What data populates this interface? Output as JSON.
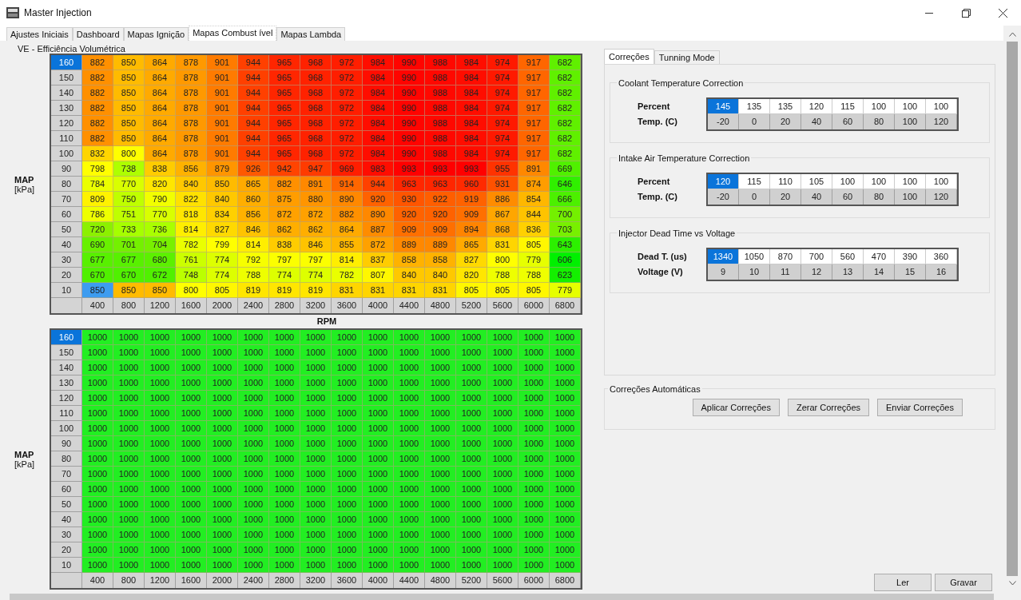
{
  "window": {
    "title": "Master Injection"
  },
  "tabs": [
    {
      "label": "Ajustes Iniciais",
      "selected": false
    },
    {
      "label": "Dashboard",
      "selected": false
    },
    {
      "label": "Mapas Ignição",
      "selected": false
    },
    {
      "label": "Mapas Combust ível",
      "selected": true
    },
    {
      "label": "Mapas Lambda",
      "selected": false
    }
  ],
  "ve_table": {
    "title": "VE - Efficiência Volumétrica",
    "y_label": "MAP",
    "y_unit": "[kPa]",
    "rows": [
      {
        "label": "160",
        "selected": true,
        "cells": [
          {
            "value": "882",
            "selected": false
          },
          {
            "value": "850",
            "selected": false
          },
          {
            "value": "864",
            "selected": false
          },
          {
            "value": "878",
            "selected": false
          },
          {
            "value": "901",
            "selected": false
          },
          {
            "value": "944",
            "selected": false
          },
          {
            "value": "965",
            "selected": false
          },
          {
            "value": "968",
            "selected": false
          },
          {
            "value": "972",
            "selected": false
          },
          {
            "value": "984",
            "selected": false
          },
          {
            "value": "990",
            "selected": false
          },
          {
            "value": "988",
            "selected": false
          },
          {
            "value": "984",
            "selected": false
          },
          {
            "value": "974",
            "selected": false
          },
          {
            "value": "917",
            "selected": false
          },
          {
            "value": "682",
            "selected": false
          }
        ]
      },
      {
        "label": "150",
        "selected": false,
        "cells": [
          {
            "value": "882",
            "selected": false
          },
          {
            "value": "850",
            "selected": false
          },
          {
            "value": "864",
            "selected": false
          },
          {
            "value": "878",
            "selected": false
          },
          {
            "value": "901",
            "selected": false
          },
          {
            "value": "944",
            "selected": false
          },
          {
            "value": "965",
            "selected": false
          },
          {
            "value": "968",
            "selected": false
          },
          {
            "value": "972",
            "selected": false
          },
          {
            "value": "984",
            "selected": false
          },
          {
            "value": "990",
            "selected": false
          },
          {
            "value": "988",
            "selected": false
          },
          {
            "value": "984",
            "selected": false
          },
          {
            "value": "974",
            "selected": false
          },
          {
            "value": "917",
            "selected": false
          },
          {
            "value": "682",
            "selected": false
          }
        ]
      },
      {
        "label": "140",
        "selected": false,
        "cells": [
          {
            "value": "882",
            "selected": false
          },
          {
            "value": "850",
            "selected": false
          },
          {
            "value": "864",
            "selected": false
          },
          {
            "value": "878",
            "selected": false
          },
          {
            "value": "901",
            "selected": false
          },
          {
            "value": "944",
            "selected": false
          },
          {
            "value": "965",
            "selected": false
          },
          {
            "value": "968",
            "selected": false
          },
          {
            "value": "972",
            "selected": false
          },
          {
            "value": "984",
            "selected": false
          },
          {
            "value": "990",
            "selected": false
          },
          {
            "value": "988",
            "selected": false
          },
          {
            "value": "984",
            "selected": false
          },
          {
            "value": "974",
            "selected": false
          },
          {
            "value": "917",
            "selected": false
          },
          {
            "value": "682",
            "selected": false
          }
        ]
      },
      {
        "label": "130",
        "selected": false,
        "cells": [
          {
            "value": "882",
            "selected": false
          },
          {
            "value": "850",
            "selected": false
          },
          {
            "value": "864",
            "selected": false
          },
          {
            "value": "878",
            "selected": false
          },
          {
            "value": "901",
            "selected": false
          },
          {
            "value": "944",
            "selected": false
          },
          {
            "value": "965",
            "selected": false
          },
          {
            "value": "968",
            "selected": false
          },
          {
            "value": "972",
            "selected": false
          },
          {
            "value": "984",
            "selected": false
          },
          {
            "value": "990",
            "selected": false
          },
          {
            "value": "988",
            "selected": false
          },
          {
            "value": "984",
            "selected": false
          },
          {
            "value": "974",
            "selected": false
          },
          {
            "value": "917",
            "selected": false
          },
          {
            "value": "682",
            "selected": false
          }
        ]
      },
      {
        "label": "120",
        "selected": false,
        "cells": [
          {
            "value": "882",
            "selected": false
          },
          {
            "value": "850",
            "selected": false
          },
          {
            "value": "864",
            "selected": false
          },
          {
            "value": "878",
            "selected": false
          },
          {
            "value": "901",
            "selected": false
          },
          {
            "value": "944",
            "selected": false
          },
          {
            "value": "965",
            "selected": false
          },
          {
            "value": "968",
            "selected": false
          },
          {
            "value": "972",
            "selected": false
          },
          {
            "value": "984",
            "selected": false
          },
          {
            "value": "990",
            "selected": false
          },
          {
            "value": "988",
            "selected": false
          },
          {
            "value": "984",
            "selected": false
          },
          {
            "value": "974",
            "selected": false
          },
          {
            "value": "917",
            "selected": false
          },
          {
            "value": "682",
            "selected": false
          }
        ]
      },
      {
        "label": "110",
        "selected": false,
        "cells": [
          {
            "value": "882",
            "selected": false
          },
          {
            "value": "850",
            "selected": false
          },
          {
            "value": "864",
            "selected": false
          },
          {
            "value": "878",
            "selected": false
          },
          {
            "value": "901",
            "selected": false
          },
          {
            "value": "944",
            "selected": false
          },
          {
            "value": "965",
            "selected": false
          },
          {
            "value": "968",
            "selected": false
          },
          {
            "value": "972",
            "selected": false
          },
          {
            "value": "984",
            "selected": false
          },
          {
            "value": "990",
            "selected": false
          },
          {
            "value": "988",
            "selected": false
          },
          {
            "value": "984",
            "selected": false
          },
          {
            "value": "974",
            "selected": false
          },
          {
            "value": "917",
            "selected": false
          },
          {
            "value": "682",
            "selected": false
          }
        ]
      },
      {
        "label": "100",
        "selected": false,
        "cells": [
          {
            "value": "832",
            "selected": false
          },
          {
            "value": "800",
            "selected": false
          },
          {
            "value": "864",
            "selected": false
          },
          {
            "value": "878",
            "selected": false
          },
          {
            "value": "901",
            "selected": false
          },
          {
            "value": "944",
            "selected": false
          },
          {
            "value": "965",
            "selected": false
          },
          {
            "value": "968",
            "selected": false
          },
          {
            "value": "972",
            "selected": false
          },
          {
            "value": "984",
            "selected": false
          },
          {
            "value": "990",
            "selected": false
          },
          {
            "value": "988",
            "selected": false
          },
          {
            "value": "984",
            "selected": false
          },
          {
            "value": "974",
            "selected": false
          },
          {
            "value": "917",
            "selected": false
          },
          {
            "value": "682",
            "selected": false
          }
        ]
      },
      {
        "label": "90",
        "selected": false,
        "cells": [
          {
            "value": "798",
            "selected": false
          },
          {
            "value": "738",
            "selected": false
          },
          {
            "value": "838",
            "selected": false
          },
          {
            "value": "856",
            "selected": false
          },
          {
            "value": "879",
            "selected": false
          },
          {
            "value": "926",
            "selected": false
          },
          {
            "value": "942",
            "selected": false
          },
          {
            "value": "947",
            "selected": false
          },
          {
            "value": "969",
            "selected": false
          },
          {
            "value": "983",
            "selected": false
          },
          {
            "value": "993",
            "selected": false
          },
          {
            "value": "993",
            "selected": false
          },
          {
            "value": "993",
            "selected": false
          },
          {
            "value": "955",
            "selected": false
          },
          {
            "value": "891",
            "selected": false
          },
          {
            "value": "669",
            "selected": false
          }
        ]
      },
      {
        "label": "80",
        "selected": false,
        "cells": [
          {
            "value": "784",
            "selected": false
          },
          {
            "value": "770",
            "selected": false
          },
          {
            "value": "820",
            "selected": false
          },
          {
            "value": "840",
            "selected": false
          },
          {
            "value": "850",
            "selected": false
          },
          {
            "value": "865",
            "selected": false
          },
          {
            "value": "882",
            "selected": false
          },
          {
            "value": "891",
            "selected": false
          },
          {
            "value": "914",
            "selected": false
          },
          {
            "value": "944",
            "selected": false
          },
          {
            "value": "963",
            "selected": false
          },
          {
            "value": "963",
            "selected": false
          },
          {
            "value": "960",
            "selected": false
          },
          {
            "value": "931",
            "selected": false
          },
          {
            "value": "874",
            "selected": false
          },
          {
            "value": "646",
            "selected": false
          }
        ]
      },
      {
        "label": "70",
        "selected": false,
        "cells": [
          {
            "value": "809",
            "selected": false
          },
          {
            "value": "750",
            "selected": false
          },
          {
            "value": "790",
            "selected": false
          },
          {
            "value": "822",
            "selected": false
          },
          {
            "value": "840",
            "selected": false
          },
          {
            "value": "860",
            "selected": false
          },
          {
            "value": "875",
            "selected": false
          },
          {
            "value": "880",
            "selected": false
          },
          {
            "value": "890",
            "selected": false
          },
          {
            "value": "920",
            "selected": false
          },
          {
            "value": "930",
            "selected": false
          },
          {
            "value": "922",
            "selected": false
          },
          {
            "value": "919",
            "selected": false
          },
          {
            "value": "886",
            "selected": false
          },
          {
            "value": "854",
            "selected": false
          },
          {
            "value": "666",
            "selected": false
          }
        ]
      },
      {
        "label": "60",
        "selected": false,
        "cells": [
          {
            "value": "786",
            "selected": false
          },
          {
            "value": "751",
            "selected": false
          },
          {
            "value": "770",
            "selected": false
          },
          {
            "value": "818",
            "selected": false
          },
          {
            "value": "834",
            "selected": false
          },
          {
            "value": "856",
            "selected": false
          },
          {
            "value": "872",
            "selected": false
          },
          {
            "value": "872",
            "selected": false
          },
          {
            "value": "882",
            "selected": false
          },
          {
            "value": "890",
            "selected": false
          },
          {
            "value": "920",
            "selected": false
          },
          {
            "value": "920",
            "selected": false
          },
          {
            "value": "909",
            "selected": false
          },
          {
            "value": "867",
            "selected": false
          },
          {
            "value": "844",
            "selected": false
          },
          {
            "value": "700",
            "selected": false
          }
        ]
      },
      {
        "label": "50",
        "selected": false,
        "cells": [
          {
            "value": "720",
            "selected": false
          },
          {
            "value": "733",
            "selected": false
          },
          {
            "value": "736",
            "selected": false
          },
          {
            "value": "814",
            "selected": false
          },
          {
            "value": "827",
            "selected": false
          },
          {
            "value": "846",
            "selected": false
          },
          {
            "value": "862",
            "selected": false
          },
          {
            "value": "862",
            "selected": false
          },
          {
            "value": "864",
            "selected": false
          },
          {
            "value": "887",
            "selected": false
          },
          {
            "value": "909",
            "selected": false
          },
          {
            "value": "909",
            "selected": false
          },
          {
            "value": "894",
            "selected": false
          },
          {
            "value": "868",
            "selected": false
          },
          {
            "value": "836",
            "selected": false
          },
          {
            "value": "703",
            "selected": false
          }
        ]
      },
      {
        "label": "40",
        "selected": false,
        "cells": [
          {
            "value": "690",
            "selected": false
          },
          {
            "value": "701",
            "selected": false
          },
          {
            "value": "704",
            "selected": false
          },
          {
            "value": "782",
            "selected": false
          },
          {
            "value": "799",
            "selected": false
          },
          {
            "value": "814",
            "selected": false
          },
          {
            "value": "838",
            "selected": false
          },
          {
            "value": "846",
            "selected": false
          },
          {
            "value": "855",
            "selected": false
          },
          {
            "value": "872",
            "selected": false
          },
          {
            "value": "889",
            "selected": false
          },
          {
            "value": "889",
            "selected": false
          },
          {
            "value": "865",
            "selected": false
          },
          {
            "value": "831",
            "selected": false
          },
          {
            "value": "805",
            "selected": false
          },
          {
            "value": "643",
            "selected": false
          }
        ]
      },
      {
        "label": "30",
        "selected": false,
        "cells": [
          {
            "value": "677",
            "selected": false
          },
          {
            "value": "677",
            "selected": false
          },
          {
            "value": "680",
            "selected": false
          },
          {
            "value": "761",
            "selected": false
          },
          {
            "value": "774",
            "selected": false
          },
          {
            "value": "792",
            "selected": false
          },
          {
            "value": "797",
            "selected": false
          },
          {
            "value": "797",
            "selected": false
          },
          {
            "value": "814",
            "selected": false
          },
          {
            "value": "837",
            "selected": false
          },
          {
            "value": "858",
            "selected": false
          },
          {
            "value": "858",
            "selected": false
          },
          {
            "value": "827",
            "selected": false
          },
          {
            "value": "800",
            "selected": false
          },
          {
            "value": "779",
            "selected": false
          },
          {
            "value": "606",
            "selected": false
          }
        ]
      },
      {
        "label": "20",
        "selected": false,
        "cells": [
          {
            "value": "670",
            "selected": false
          },
          {
            "value": "670",
            "selected": false
          },
          {
            "value": "672",
            "selected": false
          },
          {
            "value": "748",
            "selected": false
          },
          {
            "value": "774",
            "selected": false
          },
          {
            "value": "788",
            "selected": false
          },
          {
            "value": "774",
            "selected": false
          },
          {
            "value": "774",
            "selected": false
          },
          {
            "value": "782",
            "selected": false
          },
          {
            "value": "807",
            "selected": false
          },
          {
            "value": "840",
            "selected": false
          },
          {
            "value": "840",
            "selected": false
          },
          {
            "value": "820",
            "selected": false
          },
          {
            "value": "788",
            "selected": false
          },
          {
            "value": "788",
            "selected": false
          },
          {
            "value": "623",
            "selected": false
          }
        ]
      },
      {
        "label": "10",
        "selected": false,
        "cells": [
          {
            "value": "850",
            "selected": true
          },
          {
            "value": "850",
            "selected": false
          },
          {
            "value": "850",
            "selected": false
          },
          {
            "value": "800",
            "selected": false
          },
          {
            "value": "805",
            "selected": false
          },
          {
            "value": "819",
            "selected": false
          },
          {
            "value": "819",
            "selected": false
          },
          {
            "value": "819",
            "selected": false
          },
          {
            "value": "831",
            "selected": false
          },
          {
            "value": "831",
            "selected": false
          },
          {
            "value": "831",
            "selected": false
          },
          {
            "value": "831",
            "selected": false
          },
          {
            "value": "805",
            "selected": false
          },
          {
            "value": "805",
            "selected": false
          },
          {
            "value": "805",
            "selected": false
          },
          {
            "value": "779",
            "selected": false
          }
        ]
      }
    ],
    "x_axis": [
      "400",
      "800",
      "1200",
      "1600",
      "2000",
      "2400",
      "2800",
      "3200",
      "3600",
      "4000",
      "4400",
      "4800",
      "5200",
      "5600",
      "6000",
      "6800"
    ],
    "x_label": "RPM"
  },
  "second_table": {
    "y_label": "MAP",
    "y_unit": "[kPa]",
    "rows": [
      {
        "label": "160",
        "selected": true,
        "cells": [
          "1000",
          "1000",
          "1000",
          "1000",
          "1000",
          "1000",
          "1000",
          "1000",
          "1000",
          "1000",
          "1000",
          "1000",
          "1000",
          "1000",
          "1000",
          "1000"
        ]
      },
      {
        "label": "150",
        "selected": false,
        "cells": [
          "1000",
          "1000",
          "1000",
          "1000",
          "1000",
          "1000",
          "1000",
          "1000",
          "1000",
          "1000",
          "1000",
          "1000",
          "1000",
          "1000",
          "1000",
          "1000"
        ]
      },
      {
        "label": "140",
        "selected": false,
        "cells": [
          "1000",
          "1000",
          "1000",
          "1000",
          "1000",
          "1000",
          "1000",
          "1000",
          "1000",
          "1000",
          "1000",
          "1000",
          "1000",
          "1000",
          "1000",
          "1000"
        ]
      },
      {
        "label": "130",
        "selected": false,
        "cells": [
          "1000",
          "1000",
          "1000",
          "1000",
          "1000",
          "1000",
          "1000",
          "1000",
          "1000",
          "1000",
          "1000",
          "1000",
          "1000",
          "1000",
          "1000",
          "1000"
        ]
      },
      {
        "label": "120",
        "selected": false,
        "cells": [
          "1000",
          "1000",
          "1000",
          "1000",
          "1000",
          "1000",
          "1000",
          "1000",
          "1000",
          "1000",
          "1000",
          "1000",
          "1000",
          "1000",
          "1000",
          "1000"
        ]
      },
      {
        "label": "110",
        "selected": false,
        "cells": [
          "1000",
          "1000",
          "1000",
          "1000",
          "1000",
          "1000",
          "1000",
          "1000",
          "1000",
          "1000",
          "1000",
          "1000",
          "1000",
          "1000",
          "1000",
          "1000"
        ]
      },
      {
        "label": "100",
        "selected": false,
        "cells": [
          "1000",
          "1000",
          "1000",
          "1000",
          "1000",
          "1000",
          "1000",
          "1000",
          "1000",
          "1000",
          "1000",
          "1000",
          "1000",
          "1000",
          "1000",
          "1000"
        ]
      },
      {
        "label": "90",
        "selected": false,
        "cells": [
          "1000",
          "1000",
          "1000",
          "1000",
          "1000",
          "1000",
          "1000",
          "1000",
          "1000",
          "1000",
          "1000",
          "1000",
          "1000",
          "1000",
          "1000",
          "1000"
        ]
      },
      {
        "label": "80",
        "selected": false,
        "cells": [
          "1000",
          "1000",
          "1000",
          "1000",
          "1000",
          "1000",
          "1000",
          "1000",
          "1000",
          "1000",
          "1000",
          "1000",
          "1000",
          "1000",
          "1000",
          "1000"
        ]
      },
      {
        "label": "70",
        "selected": false,
        "cells": [
          "1000",
          "1000",
          "1000",
          "1000",
          "1000",
          "1000",
          "1000",
          "1000",
          "1000",
          "1000",
          "1000",
          "1000",
          "1000",
          "1000",
          "1000",
          "1000"
        ]
      },
      {
        "label": "60",
        "selected": false,
        "cells": [
          "1000",
          "1000",
          "1000",
          "1000",
          "1000",
          "1000",
          "1000",
          "1000",
          "1000",
          "1000",
          "1000",
          "1000",
          "1000",
          "1000",
          "1000",
          "1000"
        ]
      },
      {
        "label": "50",
        "selected": false,
        "cells": [
          "1000",
          "1000",
          "1000",
          "1000",
          "1000",
          "1000",
          "1000",
          "1000",
          "1000",
          "1000",
          "1000",
          "1000",
          "1000",
          "1000",
          "1000",
          "1000"
        ]
      },
      {
        "label": "40",
        "selected": false,
        "cells": [
          "1000",
          "1000",
          "1000",
          "1000",
          "1000",
          "1000",
          "1000",
          "1000",
          "1000",
          "1000",
          "1000",
          "1000",
          "1000",
          "1000",
          "1000",
          "1000"
        ]
      },
      {
        "label": "30",
        "selected": false,
        "cells": [
          "1000",
          "1000",
          "1000",
          "1000",
          "1000",
          "1000",
          "1000",
          "1000",
          "1000",
          "1000",
          "1000",
          "1000",
          "1000",
          "1000",
          "1000",
          "1000"
        ]
      },
      {
        "label": "20",
        "selected": false,
        "cells": [
          "1000",
          "1000",
          "1000",
          "1000",
          "1000",
          "1000",
          "1000",
          "1000",
          "1000",
          "1000",
          "1000",
          "1000",
          "1000",
          "1000",
          "1000",
          "1000"
        ]
      },
      {
        "label": "10",
        "selected": false,
        "cells": [
          "1000",
          "1000",
          "1000",
          "1000",
          "1000",
          "1000",
          "1000",
          "1000",
          "1000",
          "1000",
          "1000",
          "1000",
          "1000",
          "1000",
          "1000",
          "1000"
        ]
      }
    ],
    "x_axis": [
      "400",
      "800",
      "1200",
      "1600",
      "2000",
      "2400",
      "2800",
      "3200",
      "3600",
      "4000",
      "4400",
      "4800",
      "5200",
      "5600",
      "6000",
      "6800"
    ]
  },
  "right_tabs": [
    {
      "label": "Correções",
      "selected": true
    },
    {
      "label": "Tunning Mode",
      "selected": false
    }
  ],
  "corrections": [
    {
      "title": "Coolant Temperature Correction",
      "value_label": "Percent",
      "axis_label": "Temp. (C)",
      "values": [
        {
          "value": "145",
          "selected": true
        },
        {
          "value": "135",
          "selected": false
        },
        {
          "value": "135",
          "selected": false
        },
        {
          "value": "120",
          "selected": false
        },
        {
          "value": "115",
          "selected": false
        },
        {
          "value": "100",
          "selected": false
        },
        {
          "value": "100",
          "selected": false
        },
        {
          "value": "100",
          "selected": false
        }
      ],
      "axis": [
        "-20",
        "0",
        "20",
        "40",
        "60",
        "80",
        "100",
        "120"
      ]
    },
    {
      "title": "Intake Air Temperature Correction",
      "value_label": "Percent",
      "axis_label": "Temp. (C)",
      "values": [
        {
          "value": "120",
          "selected": true
        },
        {
          "value": "115",
          "selected": false
        },
        {
          "value": "110",
          "selected": false
        },
        {
          "value": "105",
          "selected": false
        },
        {
          "value": "100",
          "selected": false
        },
        {
          "value": "100",
          "selected": false
        },
        {
          "value": "100",
          "selected": false
        },
        {
          "value": "100",
          "selected": false
        }
      ],
      "axis": [
        "-20",
        "0",
        "20",
        "40",
        "60",
        "80",
        "100",
        "120"
      ]
    },
    {
      "title": "Injector Dead Time vs Voltage",
      "value_label": "Dead T. (us)",
      "axis_label": "Voltage (V)",
      "values": [
        {
          "value": "1340",
          "selected": true
        },
        {
          "value": "1050",
          "selected": false
        },
        {
          "value": "870",
          "selected": false
        },
        {
          "value": "700",
          "selected": false
        },
        {
          "value": "560",
          "selected": false
        },
        {
          "value": "470",
          "selected": false
        },
        {
          "value": "390",
          "selected": false
        },
        {
          "value": "360",
          "selected": false
        }
      ],
      "axis": [
        "9",
        "10",
        "11",
        "12",
        "13",
        "14",
        "15",
        "16"
      ]
    }
  ],
  "auto_corrections": {
    "title": "Correções Automáticas",
    "buttons": [
      "Aplicar Correções",
      "Zerar Correções",
      "Enviar Correções"
    ]
  },
  "footer_buttons": [
    "Ler",
    "Gravar"
  ]
}
